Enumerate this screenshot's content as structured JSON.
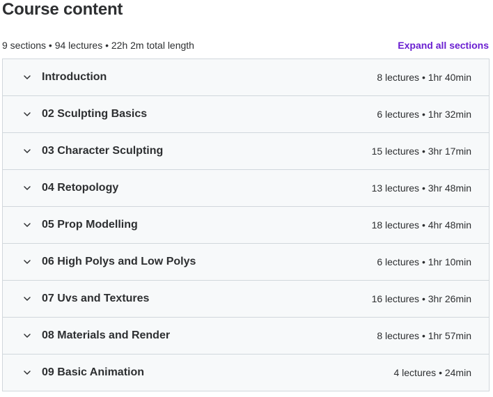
{
  "header": {
    "title": "Course content",
    "summary": "9 sections • 94 lectures • 22h 2m total length",
    "expand_label": "Expand all sections"
  },
  "sections": [
    {
      "title": "Introduction",
      "meta": "8 lectures • 1hr 40min"
    },
    {
      "title": "02 Sculpting Basics",
      "meta": "6 lectures • 1hr 32min"
    },
    {
      "title": "03 Character Sculpting",
      "meta": "15 lectures • 3hr 17min"
    },
    {
      "title": "04 Retopology",
      "meta": "13 lectures • 3hr 48min"
    },
    {
      "title": "05 Prop Modelling",
      "meta": "18 lectures • 4hr 48min"
    },
    {
      "title": "06 High Polys and Low Polys",
      "meta": "6 lectures • 1hr 10min"
    },
    {
      "title": "07 Uvs and Textures",
      "meta": "16 lectures • 3hr 26min"
    },
    {
      "title": "08 Materials and Render",
      "meta": "8 lectures • 1hr 57min"
    },
    {
      "title": "09 Basic Animation",
      "meta": "4 lectures • 24min"
    }
  ],
  "icons": {
    "section_toggle": "chevron-down-icon"
  },
  "colors": {
    "accent": "#6a1fd1",
    "section_bg": "#f7f9fa",
    "border": "#d1d7dc"
  }
}
